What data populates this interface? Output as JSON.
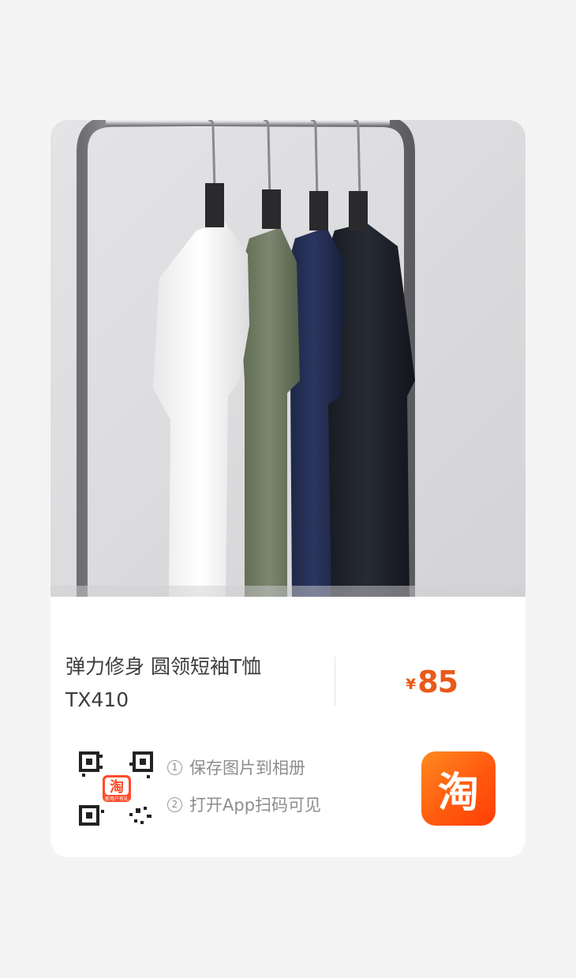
{
  "product": {
    "image_icon": "tshirts-on-rack-photo",
    "title": "弹力修身 圆领短袖T恤 TX410",
    "currency": "¥",
    "price": "85",
    "price_color": "#e85a1a"
  },
  "share": {
    "qr_badge_text": "淘",
    "qr_badge_subtext": "新用户有礼",
    "steps": [
      {
        "num": "1",
        "text": "保存图片到相册"
      },
      {
        "num": "2",
        "text": "打开App扫码可见"
      }
    ],
    "app_logo_text": "淘",
    "app_logo_color": "#ff5a0e"
  }
}
